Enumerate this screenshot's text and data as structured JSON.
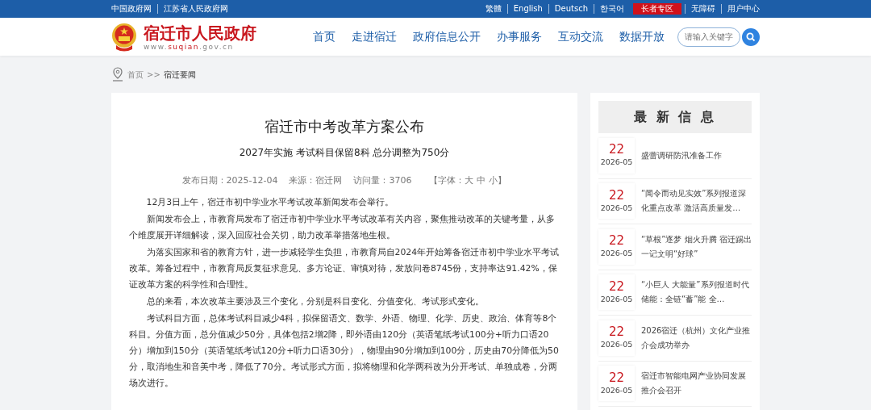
{
  "top_bar": {
    "left_links": [
      "中国政府网",
      "江苏省人民政府网"
    ],
    "right_links": [
      {
        "label": "繁體",
        "kind": "link"
      },
      {
        "label": "English",
        "kind": "link"
      },
      {
        "label": "Deutsch",
        "kind": "link"
      },
      {
        "label": "한국어",
        "kind": "link"
      },
      {
        "label": "长者专区",
        "kind": "badge"
      },
      {
        "label": "无障碍",
        "kind": "link"
      },
      {
        "label": "用户中心",
        "kind": "link"
      }
    ]
  },
  "header": {
    "site_title": "宿迁市人民政府",
    "url": {
      "prefix": "www.",
      "domain": "suqian",
      "suffix": ".gov.cn"
    },
    "nav": [
      "首页",
      "走进宿迁",
      "政府信息公开",
      "办事服务",
      "互动交流",
      "数据开放"
    ],
    "search": {
      "placeholder": "请输入关键字"
    }
  },
  "breadcrumb": {
    "items": [
      "首页",
      "宿迁要闻"
    ],
    "separator": ">>"
  },
  "article": {
    "title": "宿迁市中考改革方案公布",
    "subtitle": "2027年实施 考试科目保留8科 总分调整为750分",
    "meta": [
      "发布日期：2025-12-04",
      "来源：宿迁网",
      "访问量：3706"
    ],
    "font_size": {
      "open": "【字体：",
      "sizes": [
        "大",
        "中",
        "小"
      ],
      "close": "】"
    },
    "paragraphs": [
      "12月3日上午，宿迁市初中学业水平考试改革新闻发布会举行。",
      "新闻发布会上，市教育局发布了宿迁市初中学业水平考试改革有关内容，聚焦推动改革的关键考量，从多个维度展开详细解读，深入回应社会关切，助力改革举措落地生根。",
      "为落实国家和省的教育方针，进一步减轻学生负担，市教育局自2024年开始筹备宿迁市初中学业水平考试改革。筹备过程中，市教育局反复征求意见、多方论证、审慎对待，发放问卷8745份，支持率达91.42%，保证改革方案的科学性和合理性。",
      "总的来看，本次改革主要涉及三个变化，分别是科目变化、分值变化、考试形式变化。",
      "考试科目方面，总体考试科目减少4科，拟保留语文、数学、外语、物理、化学、历史、政治、体育等8个科目。分值方面，总分值减少50分，具体包括2增2降，即外语由120分（英语笔纸考试100分+听力口语20分）增加到150分（英语笔纸考试120分+听力口语30分），物理由90分增加到100分，历史由70分降低为50分，取消地生和音美中考，降低了70分。考试形式方面，拟将物理和化学两科改为分开考试、单独成卷，分两场次进行。"
    ]
  },
  "sidebar": {
    "title": "最 新 信 息",
    "items": [
      {
        "day": "22",
        "month": "2026-05",
        "title": "盛蕾调研防汛准备工作"
      },
      {
        "day": "22",
        "month": "2026-05",
        "title": "“闻令而动见实效”系列报道深化重点改革 激活高质量发…"
      },
      {
        "day": "22",
        "month": "2026-05",
        "title": "“草根”逐梦 烟火升腾 宿迁踢出一记文明“好球”"
      },
      {
        "day": "22",
        "month": "2026-05",
        "title": "“小巨人 大能量”系列报道时代储能：全链“蓄”能 全…"
      },
      {
        "day": "22",
        "month": "2026-05",
        "title": "2026宿迁（杭州）文化产业推介会成功举办"
      },
      {
        "day": "22",
        "month": "2026-05",
        "title": "宿迁市智能电网产业协同发展推介会召开"
      }
    ]
  }
}
